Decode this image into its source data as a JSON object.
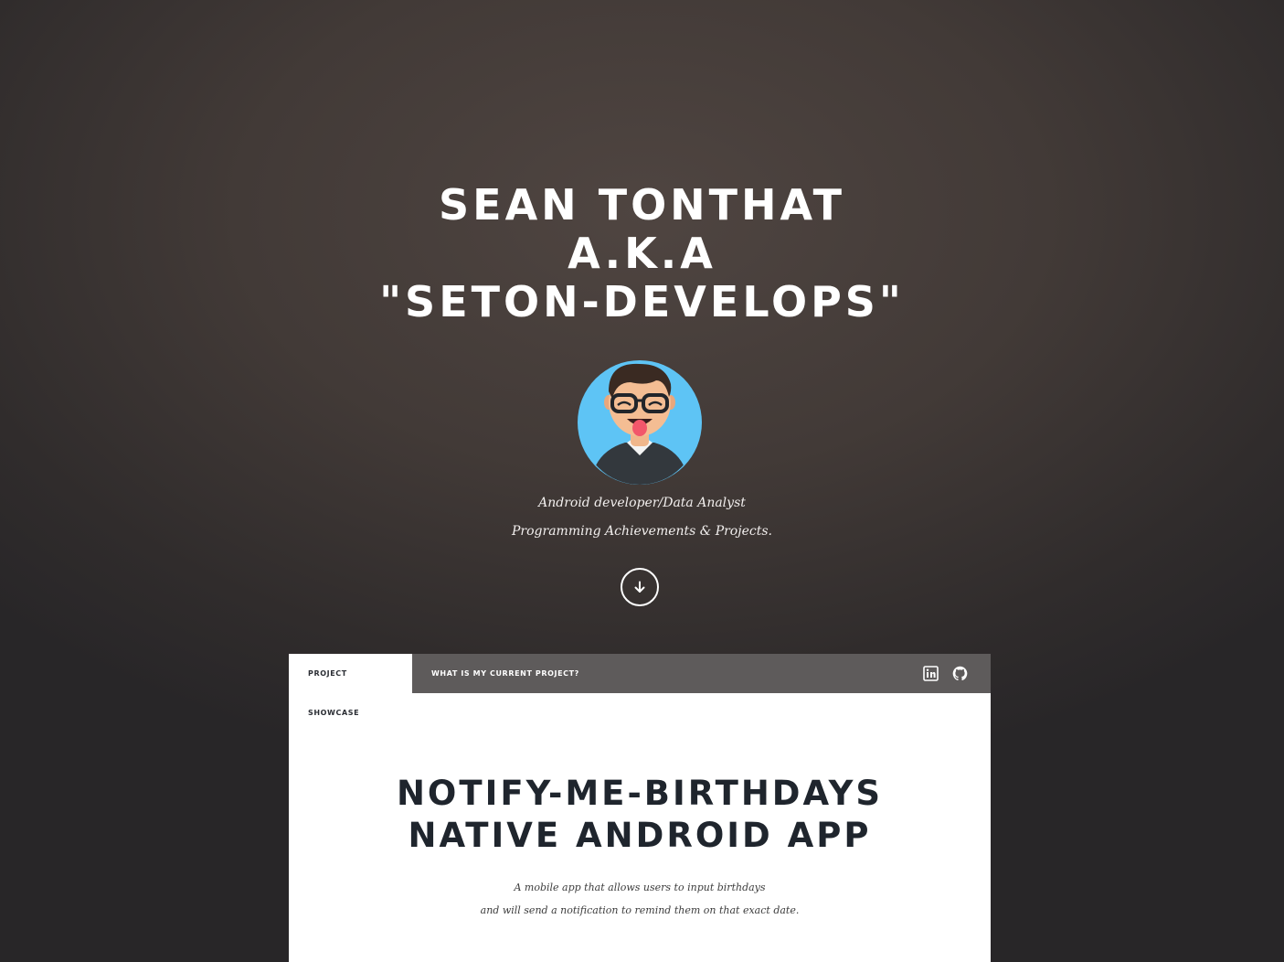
{
  "hero": {
    "title_line1": "SEAN TONTHAT",
    "title_line2": "A.K.A",
    "title_line3": "\"SETON-DEVELOPS\"",
    "avatar_icon": "cartoon-avatar-icon",
    "tagline_line1": "Android developer/Data Analyst",
    "tagline_line2": "Programming Achievements & Projects.",
    "scroll_icon": "arrow-down-icon"
  },
  "nav": {
    "tabs": [
      {
        "label": "PROJECT SHOWCASE",
        "active": true
      },
      {
        "label": "WHAT IS MY CURRENT PROJECT?",
        "active": false
      }
    ],
    "social": [
      {
        "icon": "linkedin-icon"
      },
      {
        "icon": "github-icon"
      }
    ]
  },
  "project": {
    "title_line1": "NOTIFY-ME-BIRTHDAYS",
    "title_line2": "NATIVE ANDROID APP",
    "desc_line1": "A mobile app that allows users to input birthdays",
    "desc_line2": "and will send a notification to remind them on that exact date."
  },
  "colors": {
    "background": "#423a37",
    "panel": "#ffffff",
    "tabbar": "#5e5b5b",
    "heading_dark": "#1f252d",
    "avatar_bg": "#5ec4f5"
  }
}
